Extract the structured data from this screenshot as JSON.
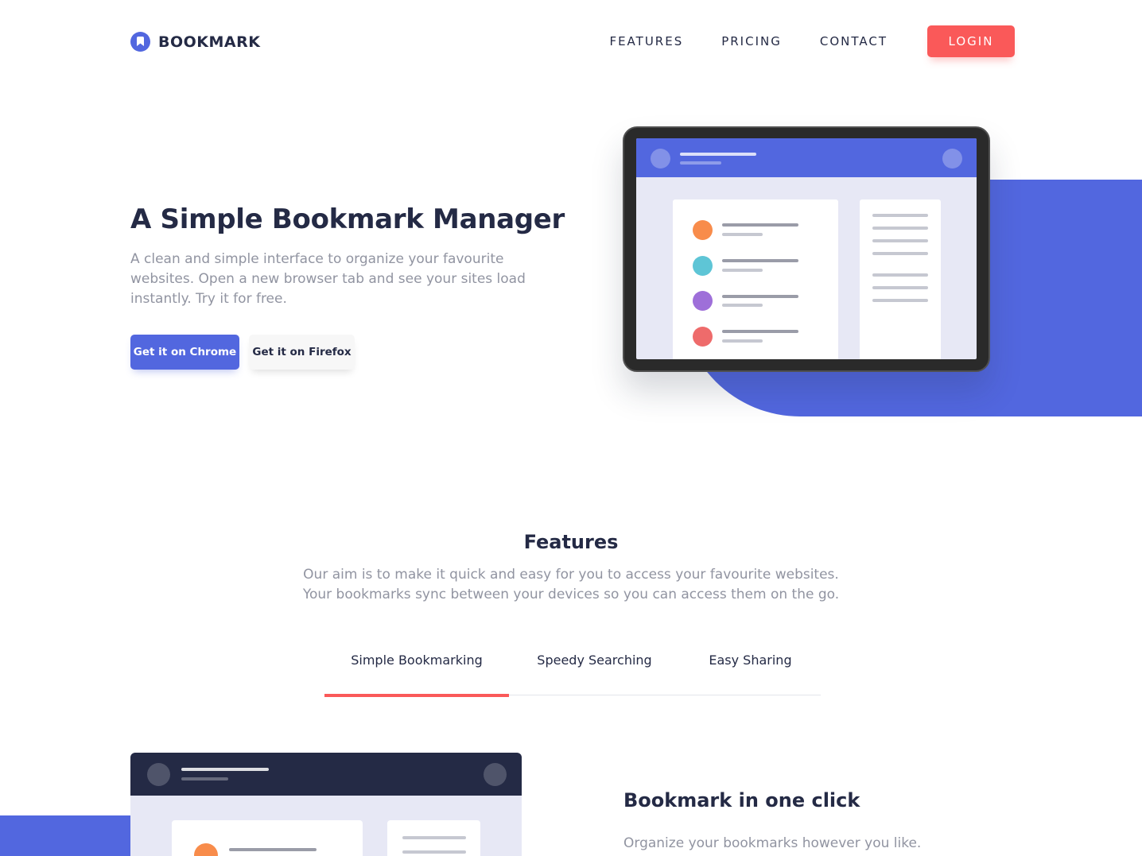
{
  "header": {
    "logo_text": "BOOKMARK",
    "nav": [
      "FEATURES",
      "PRICING",
      "CONTACT"
    ],
    "login_label": "LOGIN"
  },
  "hero": {
    "title": "A Simple Bookmark Manager",
    "text": "A clean and simple interface to organize your favourite websites. Open a new browser tab and see your sites load instantly. Try it for free.",
    "chrome_label": "Get it on Chrome",
    "firefox_label": "Get it on Firefox"
  },
  "features": {
    "title": "Features",
    "text": "Our aim is to make it quick and easy for you to access your favourite websites. Your bookmarks sync between your devices so you can access them on the go.",
    "tabs": [
      "Simple Bookmarking",
      "Speedy Searching",
      "Easy Sharing"
    ],
    "active_tab": 0,
    "panel_title": "Bookmark in one click",
    "panel_text": "Organize your bookmarks however you like."
  },
  "colors": {
    "primary": "#5267df",
    "accent": "#fa5959",
    "dark": "#242a45",
    "grey": "#9194a1",
    "bookmark_dots": [
      "#f88c4b",
      "#5ec5d6",
      "#9e6fd9",
      "#ee6b6b"
    ]
  }
}
